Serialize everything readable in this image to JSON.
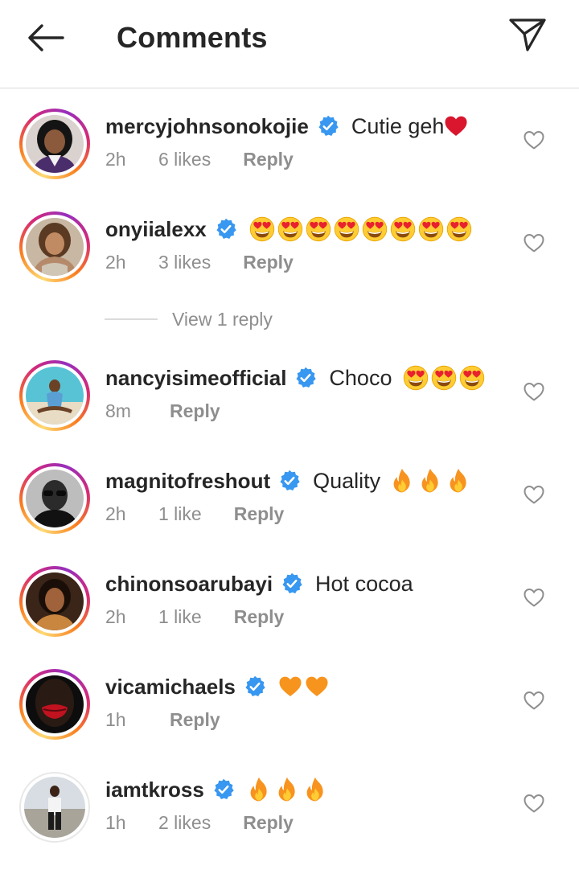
{
  "header": {
    "title": "Comments",
    "back_icon": "arrow-left-icon",
    "send_icon": "paper-plane-icon"
  },
  "colors": {
    "verified": "#3897f0",
    "meta": "#8e8e8e",
    "text": "#262626",
    "divider": "#dbdbdb"
  },
  "comments": [
    {
      "username": "mercyjohnsonokojie",
      "verified": true,
      "text": "Cutie geh",
      "emojis": [
        "red-heart"
      ],
      "time": "2h",
      "likes": "6 likes",
      "reply": "Reply"
    },
    {
      "username": "onyiialexx",
      "verified": true,
      "text": "",
      "emojis": [
        "heart-eyes",
        "heart-eyes",
        "heart-eyes",
        "heart-eyes",
        "heart-eyes",
        "heart-eyes",
        "heart-eyes",
        "heart-eyes"
      ],
      "time": "2h",
      "likes": "3 likes",
      "reply": "Reply"
    },
    {
      "username": "nancyisimeofficial",
      "verified": true,
      "text": "Choco",
      "emojis": [
        "heart-eyes",
        "heart-eyes",
        "heart-eyes"
      ],
      "time": "8m",
      "likes": "",
      "reply": "Reply"
    },
    {
      "username": "magnitofreshout",
      "verified": true,
      "text": "Quality",
      "emojis": [
        "fire",
        "fire",
        "fire"
      ],
      "time": "2h",
      "likes": "1 like",
      "reply": "Reply"
    },
    {
      "username": "chinonsoarubayi",
      "verified": true,
      "text": "Hot cocoa",
      "emojis": [],
      "time": "2h",
      "likes": "1 like",
      "reply": "Reply"
    },
    {
      "username": "vicamichaels",
      "verified": true,
      "text": "",
      "emojis": [
        "orange-heart",
        "orange-heart"
      ],
      "time": "1h",
      "likes": "",
      "reply": "Reply"
    },
    {
      "username": "iamtkross",
      "verified": true,
      "text": "",
      "emojis": [
        "fire",
        "fire",
        "fire"
      ],
      "time": "1h",
      "likes": "2 likes",
      "reply": "Reply"
    }
  ],
  "view_replies": {
    "label": "View 1 reply"
  }
}
